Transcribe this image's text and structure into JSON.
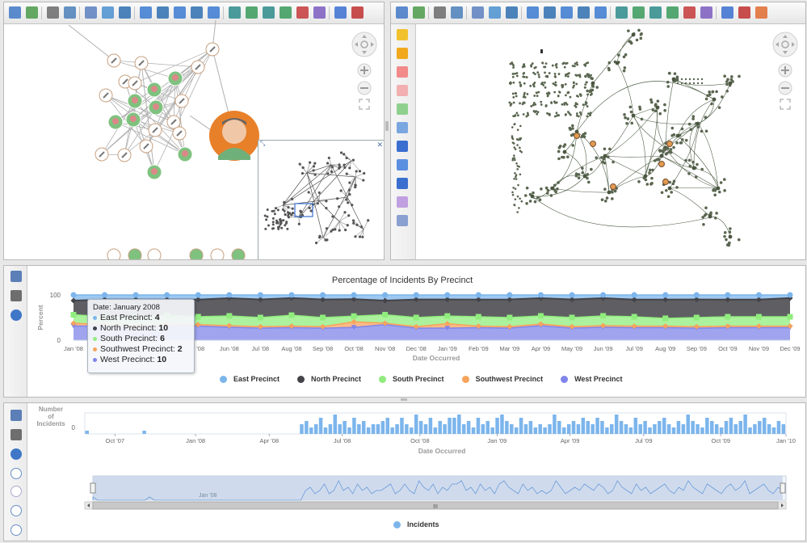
{
  "colors": {
    "east": "#7cb5ec",
    "north": "#434348",
    "south": "#90ed7d",
    "southwest": "#f7a35c",
    "west": "#8085e9",
    "incidents": "#7cb5ec",
    "person_green": "#7fc27f",
    "focus_orange": "#e8802a"
  },
  "top_left_toolbar": {
    "icons": [
      "layout-icon",
      "export-icon",
      "print-icon",
      "print-preview-icon",
      "select-icon",
      "pan-icon",
      "move-icon",
      "zoom-in-icon",
      "zoom-out-icon",
      "zoom-fit-icon",
      "zoom-window-icon",
      "zoom-selection-icon",
      "layout-hierarchy-icon",
      "layout-circular-icon",
      "layout-grid-icon",
      "layout-organic-icon",
      "layout-tree-icon",
      "layout-radial-icon",
      "share-icon",
      "clear-icon"
    ]
  },
  "top_right_toolbar": {
    "icons": [
      "layout-icon",
      "export-icon",
      "print-icon",
      "print-preview-icon",
      "select-icon",
      "pan-icon",
      "move-icon",
      "zoom-in-icon",
      "zoom-out-icon",
      "zoom-fit-icon",
      "zoom-window-icon",
      "zoom-selection-icon",
      "layout-hierarchy-icon",
      "layout-circular-icon",
      "layout-grid-icon",
      "layout-organic-icon",
      "layout-tree-icon",
      "layout-radial-icon",
      "network-icon",
      "bullseye-icon",
      "settings-icon"
    ]
  },
  "right_side_toolbar": {
    "icons": [
      "star-icon",
      "star-add-icon",
      "expand-neighbors-icon",
      "collapse-neighbors-icon",
      "checkmark-icon",
      "filter-icon",
      "filter-remove-icon",
      "step-forward-icon",
      "step-back-icon",
      "refresh-icon",
      "table-icon"
    ]
  },
  "chart1": {
    "chart_data": {
      "type": "area",
      "stacking": "percent",
      "title": "Percentage of Incidents By Precinct",
      "xlabel": "Date Occurred",
      "ylabel": "Percent",
      "y_ticks": [
        "0",
        "100"
      ],
      "x_ticks": [
        "Jan '08",
        "Feb '08",
        "Mar '08",
        "Apr '08",
        "May '08",
        "Jun '08",
        "Jul '08",
        "Aug '08",
        "Sep '08",
        "Oct '08",
        "Nov '08",
        "Dec '08",
        "Jan '09",
        "Feb '09",
        "Mar '09",
        "Apr '09",
        "May '09",
        "Jun '09",
        "Jul '09",
        "Aug '09",
        "Sep '09",
        "Oct '09",
        "Nov '09",
        "Dec '09"
      ],
      "visible_x_tick_labels": [
        "Jan '08",
        "'08",
        "Jun '08",
        "Jul '08",
        "Aug '08",
        "Sep '08",
        "Oct '08",
        "Nov '08",
        "Dec '08",
        "Jan '09",
        "Feb '09",
        "Mar '09",
        "Apr '09",
        "May '09",
        "Jun '09",
        "Jul '09",
        "Aug '09",
        "Sep '09",
        "Oct '09",
        "Nov '09",
        "Dec '09"
      ],
      "series": [
        {
          "name": "East Precinct",
          "values": [
            4,
            3,
            3,
            3,
            3,
            2,
            3,
            2,
            3,
            3,
            4,
            3,
            3,
            3,
            3,
            2,
            3,
            2,
            3,
            3,
            3,
            3,
            3,
            2
          ]
        },
        {
          "name": "North Precinct",
          "values": [
            10,
            11,
            11,
            10,
            11,
            11,
            12,
            11,
            12,
            12,
            10,
            12,
            11,
            11,
            12,
            11,
            12,
            11,
            11,
            12,
            12,
            11,
            11,
            12
          ]
        },
        {
          "name": "South Precinct",
          "values": [
            6,
            5,
            6,
            6,
            5,
            6,
            6,
            7,
            6,
            4,
            6,
            6,
            5,
            6,
            6,
            5,
            6,
            6,
            6,
            5,
            6,
            6,
            6,
            6
          ]
        },
        {
          "name": "Southwest Precinct",
          "values": [
            2,
            1,
            1,
            1,
            1,
            1,
            1,
            1,
            1,
            4,
            1,
            1,
            3,
            1,
            1,
            1,
            1,
            1,
            1,
            1,
            1,
            1,
            1,
            1
          ]
        },
        {
          "name": "West Precinct",
          "values": [
            10,
            9,
            8,
            9,
            9,
            8,
            8,
            8,
            8,
            9,
            11,
            8,
            8,
            8,
            8,
            9,
            8,
            8,
            8,
            8,
            8,
            8,
            8,
            8
          ]
        }
      ],
      "legend_position": "bottom"
    },
    "tooltip": {
      "date_line": "Date: January 2008",
      "rows": [
        {
          "label": "East Precinct: ",
          "value": "4"
        },
        {
          "label": "North Precinct: ",
          "value": "10"
        },
        {
          "label": "South Precinct: ",
          "value": "6"
        },
        {
          "label": "Southwest Precinct: ",
          "value": "2"
        },
        {
          "label": "West Precinct: ",
          "value": "10"
        }
      ]
    },
    "legend": [
      "East Precinct",
      "North Precinct",
      "South Precinct",
      "Southwest Precinct",
      "West Precinct"
    ]
  },
  "chart2": {
    "chart_data": {
      "type": "bar",
      "xlabel": "Date Occurred",
      "ylabel": "Number of Incidents",
      "y_ticks": [
        "0"
      ],
      "x_ticks": [
        "Oct '07",
        "Jan '08",
        "Apr '08",
        "Jul '08",
        "Oct '08",
        "Jan '09",
        "Apr '09",
        "Jul '09",
        "Oct '09",
        "Jan '10"
      ],
      "series": [
        {
          "name": "Incidents",
          "values": [
            1,
            0,
            0,
            0,
            0,
            0,
            0,
            0,
            0,
            0,
            0,
            0,
            1,
            0,
            0,
            0,
            0,
            0,
            0,
            0,
            0,
            0,
            0,
            0,
            0,
            0,
            0,
            0,
            0,
            0,
            0,
            0,
            0,
            0,
            0,
            0,
            0,
            0,
            0,
            0,
            0,
            0,
            0,
            0,
            0,
            3,
            4,
            2,
            3,
            5,
            2,
            3,
            6,
            3,
            4,
            2,
            5,
            3,
            4,
            2,
            3,
            3,
            4,
            5,
            2,
            3,
            5,
            3,
            2,
            6,
            4,
            3,
            5,
            2,
            4,
            3,
            5,
            5,
            6,
            3,
            4,
            2,
            5,
            3,
            4,
            2,
            5,
            6,
            4,
            3,
            2,
            5,
            3,
            4,
            2,
            3,
            2,
            3,
            6,
            4,
            2,
            3,
            4,
            3,
            5,
            4,
            3,
            5,
            4,
            2,
            3,
            6,
            4,
            3,
            2,
            5,
            3,
            4,
            2,
            3,
            4,
            5,
            3,
            2,
            4,
            3,
            6,
            4,
            3,
            2,
            5,
            4,
            3,
            2,
            4,
            5,
            3,
            4,
            6,
            2,
            3,
            4,
            5,
            3,
            2,
            4,
            3
          ]
        }
      ]
    },
    "legend": [
      "Incidents"
    ],
    "navigator": {
      "series_label": "Jan '08"
    },
    "scroll_center": "III"
  },
  "bottom_side_toolbar": {
    "icons": [
      "layout-icon",
      "print-icon",
      "zoom-icon",
      "play-icon",
      "pause-icon",
      "reset-icon",
      "step-end-icon"
    ]
  }
}
